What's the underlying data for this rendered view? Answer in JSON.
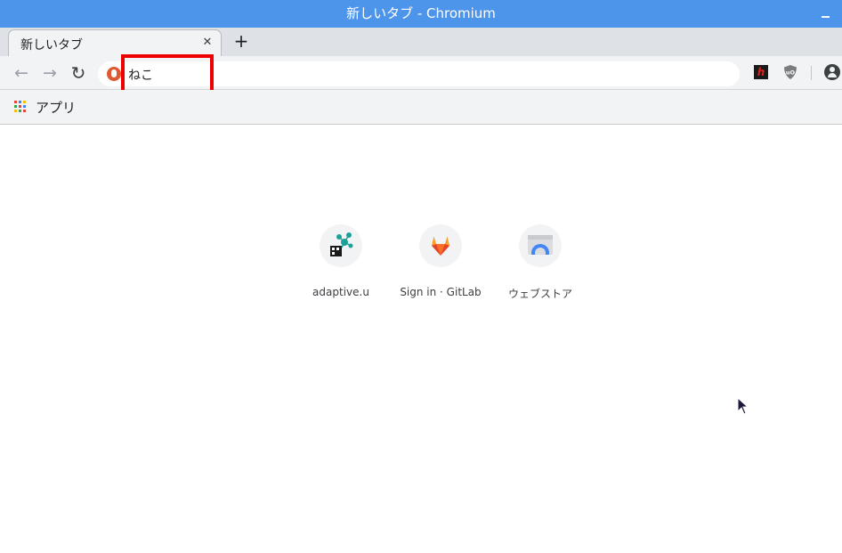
{
  "window": {
    "title": "新しいタブ - Chromium"
  },
  "tabs": [
    {
      "title": "新しいタブ",
      "close_label": "✕"
    }
  ],
  "new_tab_label": "+",
  "toolbar": {
    "back_icon": "←",
    "forward_icon": "→",
    "reload_icon": "↻",
    "omnibox_value": "ねこ",
    "search_engine_icon": "duckduckgo-icon",
    "extensions": [
      {
        "name": "h-extension-icon",
        "glyph": "h"
      },
      {
        "name": "ublock-icon",
        "glyph": "uO"
      }
    ],
    "highlight_color": "#ef0000"
  },
  "bookmarks": {
    "apps_label": "アプリ"
  },
  "shortcuts": [
    {
      "label": "adaptive.u",
      "icon": "adaptive-icon"
    },
    {
      "label": "Sign in · GitLab",
      "icon": "gitlab-icon"
    },
    {
      "label": "ウェブストア",
      "icon": "webstore-icon"
    }
  ],
  "colors": {
    "titlebar": "#4d94eb",
    "gitlab": "#e24329",
    "webstore": "#4285f4"
  }
}
